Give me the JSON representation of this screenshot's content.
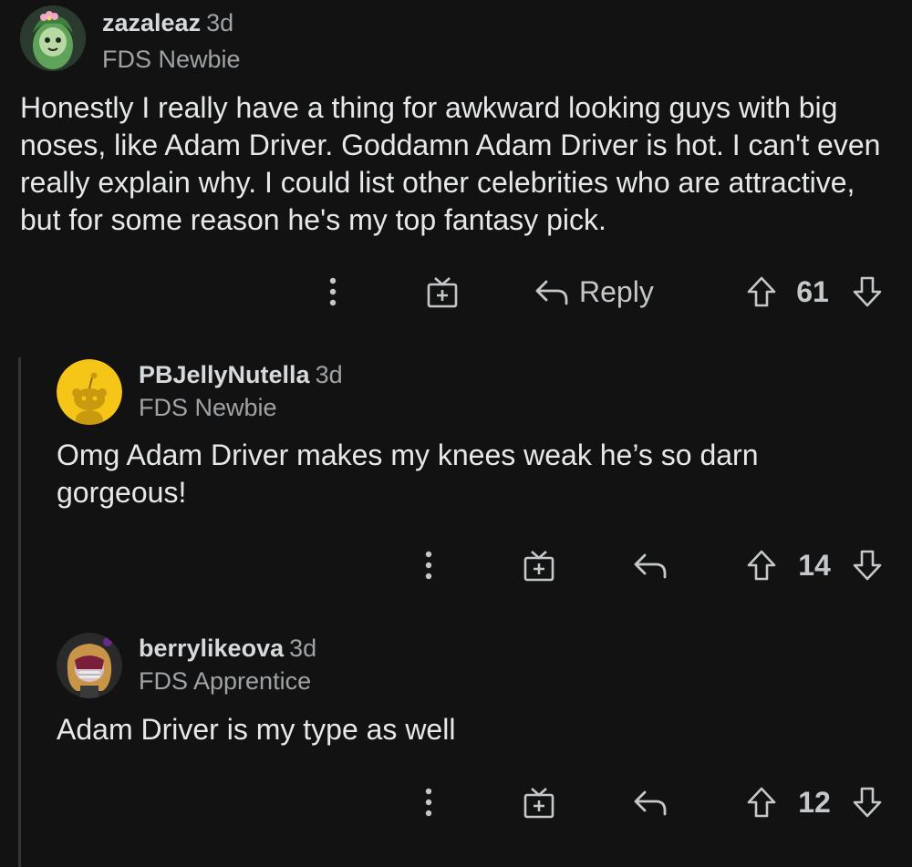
{
  "comments": [
    {
      "username": "zazaleaz",
      "age": "3d",
      "flair": "FDS Newbie",
      "body": "Honestly I really have a thing for awkward looking guys with big noses, like Adam Driver. Goddamn Adam Driver is hot. I can't even really explain why. I could list other celebrities who are attractive, but for some reason he's my top fantasy pick.",
      "reply_label": "Reply",
      "score": "61",
      "avatar_icon": "green-character-avatar-icon"
    },
    {
      "username": "PBJellyNutella",
      "age": "3d",
      "flair": "FDS Newbie",
      "body": "Omg Adam Driver makes my knees weak he’s so darn gorgeous!",
      "score": "14",
      "avatar_icon": "default-snoo-avatar-icon"
    },
    {
      "username": "berrylikeova",
      "age": "3d",
      "flair": "FDS Apprentice",
      "body": "Adam Driver is my type as well",
      "score": "12",
      "avatar_icon": "custom-character-avatar-icon"
    }
  ],
  "colors": {
    "background": "#121212",
    "text": "#d7dadc",
    "muted": "#9fa3a6",
    "thread_line": "#343536",
    "snoo_yellow": "#f5c518"
  }
}
